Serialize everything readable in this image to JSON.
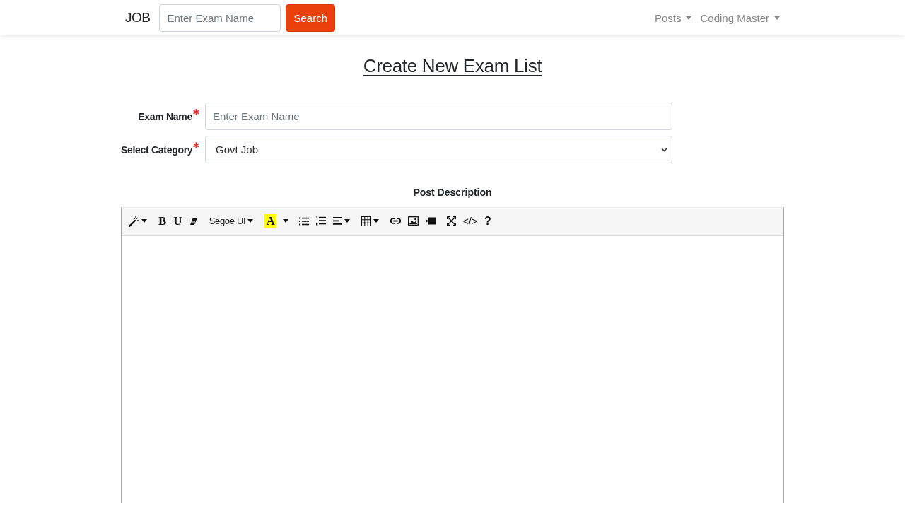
{
  "navbar": {
    "brand": "JOB",
    "search": {
      "placeholder": "Enter Exam Name",
      "button": "Search"
    },
    "menus": [
      {
        "label": "Posts"
      },
      {
        "label": "Coding Master"
      }
    ]
  },
  "heading": "Create New Exam List",
  "form": {
    "fields": [
      {
        "kind": "input",
        "label": "Exam Name",
        "required": true,
        "placeholder": "Enter Exam Name"
      },
      {
        "kind": "select",
        "label": "Select Category",
        "required": true,
        "value": "Govt Job"
      }
    ]
  },
  "editor": {
    "label": "Post Description",
    "toolbar": [
      [
        {
          "kind": "wand",
          "dropdown": true
        }
      ],
      [
        {
          "kind": "bold",
          "text": "B"
        },
        {
          "kind": "underline",
          "text": "U"
        },
        {
          "kind": "eraser",
          "dropdown": false
        }
      ],
      [
        {
          "kind": "font",
          "text": "Segoe UI",
          "dropdown": true
        }
      ],
      [
        {
          "kind": "color",
          "text": "A"
        },
        {
          "kind": "caret",
          "dropdown": true
        }
      ],
      [
        {
          "kind": "bullets",
          "dropdown": false
        },
        {
          "kind": "numbers",
          "dropdown": false
        },
        {
          "kind": "align",
          "dropdown": true
        }
      ],
      [
        {
          "kind": "table",
          "dropdown": true
        }
      ],
      [
        {
          "kind": "link",
          "dropdown": false
        },
        {
          "kind": "image",
          "dropdown": false
        },
        {
          "kind": "video",
          "dropdown": false
        }
      ],
      [
        {
          "kind": "expand",
          "dropdown": false
        },
        {
          "kind": "code",
          "text": "</>"
        },
        {
          "kind": "help",
          "text": "?"
        }
      ]
    ]
  }
}
